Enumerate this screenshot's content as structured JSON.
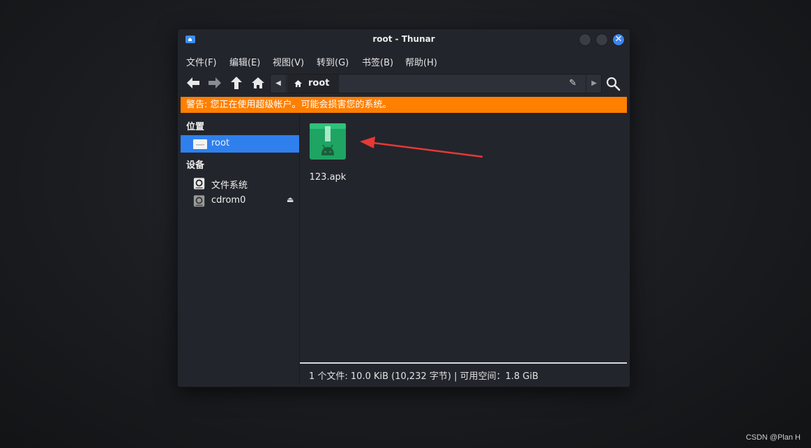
{
  "window": {
    "title": "root - Thunar",
    "close_glyph": "✕"
  },
  "menubar": {
    "items": [
      "文件(F)",
      "编辑(E)",
      "视图(V)",
      "转到(G)",
      "书签(B)",
      "帮助(H)"
    ]
  },
  "toolbar": {
    "icons": [
      "back-icon",
      "forward-icon",
      "up-icon",
      "home-icon",
      "search-icon"
    ],
    "location": "root"
  },
  "warning": {
    "text": "警告: 您正在使用超级帐户。可能会损害您的系统。",
    "color": "#ff7f00"
  },
  "sidebar": {
    "places_heading": "位置",
    "places": [
      {
        "label": "root",
        "icon": "folder-icon",
        "selected": true
      }
    ],
    "devices_heading": "设备",
    "devices": [
      {
        "label": "文件系统",
        "icon": "drive-icon"
      },
      {
        "label": "cdrom0",
        "icon": "cdrom-icon",
        "eject": true
      }
    ],
    "eject_glyph": "⏏"
  },
  "files": [
    {
      "name": "123.apk",
      "icon": "apk-package-icon"
    }
  ],
  "status": {
    "text": "1 个文件: 10.0 KiB (10,232 字节) | 可用空间：1.8 GiB"
  },
  "annotation": {
    "color": "#e53935"
  },
  "accent": "#2f80ed",
  "watermark": "CSDN @Plan H"
}
